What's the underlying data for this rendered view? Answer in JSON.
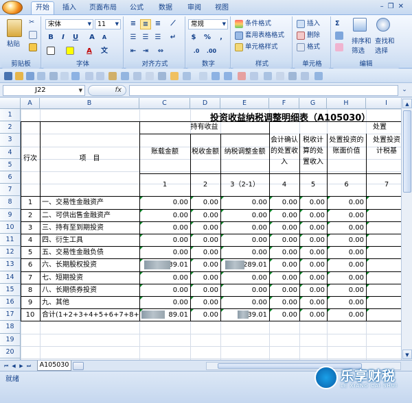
{
  "ribbon_tabs": [
    "开始",
    "插入",
    "页面布局",
    "公式",
    "数据",
    "审阅",
    "视图"
  ],
  "ribbon": {
    "clipboard": {
      "label": "剪贴板",
      "paste": "粘贴"
    },
    "font": {
      "label": "字体",
      "name": "宋体",
      "size": "11"
    },
    "alignment": {
      "label": "对齐方式"
    },
    "number": {
      "label": "数字",
      "format": "常规"
    },
    "styles": {
      "label": "样式",
      "conditional": "条件格式",
      "table_format": "套用表格格式",
      "cell_styles": "单元格样式"
    },
    "cells": {
      "label": "单元格",
      "insert": "插入",
      "delete": "删除",
      "format": "格式"
    },
    "editing": {
      "label": "编辑",
      "sort_filter_1": "排序和",
      "sort_filter_2": "筛选",
      "find_select_1": "查找和",
      "find_select_2": "选择"
    }
  },
  "formula_bar": {
    "name_box": "J22",
    "fx": "fx",
    "formula": ""
  },
  "sheet": {
    "columns": [
      "A",
      "B",
      "C",
      "D",
      "E",
      "F",
      "G",
      "H",
      "I"
    ],
    "rows": [
      "1",
      "2",
      "3",
      "4",
      "5",
      "6",
      "7",
      "8",
      "9",
      "10",
      "11",
      "12",
      "13",
      "14",
      "15",
      "16",
      "17",
      "18",
      "19",
      "20",
      "21",
      "22"
    ],
    "title": "投资收益纳税调整明细表（A105030）",
    "header": {
      "seq": "行次",
      "item": "项　目",
      "holding": "持有收益",
      "disposal": "处置",
      "c": "账载金额",
      "d": "税收金额",
      "e": "纳税调整金额",
      "f": [
        "会计确认",
        "的处置收",
        "入"
      ],
      "g": [
        "税收计",
        "算的处",
        "置收入"
      ],
      "h": [
        "处置投资的",
        "账面价值"
      ],
      "i": [
        "处置投资",
        "计税基"
      ],
      "nums": [
        "1",
        "2",
        "3（2-1）",
        "4",
        "5",
        "6",
        "7"
      ]
    },
    "data_rows": [
      {
        "seq": "1",
        "item": "一、交易性金融资产",
        "c": "0.00",
        "d": "0.00",
        "e": "0.00",
        "f": "0.00",
        "g": "0.00",
        "h": "0.00",
        "i": "0"
      },
      {
        "seq": "2",
        "item": "二、可供出售金融资产",
        "c": "0.00",
        "d": "0.00",
        "e": "0.00",
        "f": "0.00",
        "g": "0.00",
        "h": "0.00",
        "i": "0"
      },
      {
        "seq": "3",
        "item": "三、持有至到期投资",
        "c": "0.00",
        "d": "0.00",
        "e": "0.00",
        "f": "0.00",
        "g": "0.00",
        "h": "0.00",
        "i": "0"
      },
      {
        "seq": "4",
        "item": "四、衍生工具",
        "c": "0.00",
        "d": "0.00",
        "e": "0.00",
        "f": "0.00",
        "g": "0.00",
        "h": "0.00",
        "i": "0"
      },
      {
        "seq": "5",
        "item": "五、交易性金融负债",
        "c": "0.00",
        "d": "0.00",
        "e": "0.00",
        "f": "0.00",
        "g": "0.00",
        "h": "0.00",
        "i": "0"
      },
      {
        "seq": "6",
        "item": "六、长期股权投资",
        "c": "39.01",
        "d": "0.00",
        "e": "289.01",
        "f": "0.00",
        "g": "0.00",
        "h": "0.00",
        "i": "0"
      },
      {
        "seq": "7",
        "item": "七、短期投资",
        "c": "0.00",
        "d": "0.00",
        "e": "0.00",
        "f": "0.00",
        "g": "0.00",
        "h": "0.00",
        "i": "0"
      },
      {
        "seq": "8",
        "item": "八、长期债券投资",
        "c": "0.00",
        "d": "0.00",
        "e": "0.00",
        "f": "0.00",
        "g": "0.00",
        "h": "0.00",
        "i": "0"
      },
      {
        "seq": "9",
        "item": "九、其他",
        "c": "0.00",
        "d": "0.00",
        "e": "0.00",
        "f": "0.00",
        "g": "0.00",
        "h": "0.00",
        "i": "0"
      },
      {
        "seq": "10",
        "item": "合计(1+2+3+4+5+6+7+8+9)",
        "c": "89.01",
        "d": "0.00",
        "e": "39.01",
        "f": "0.00",
        "g": "0.00",
        "h": "0.00",
        "i": "0"
      }
    ]
  },
  "sheet_tab": "A105030",
  "status": "就绪",
  "watermark": {
    "main": "乐享财税",
    "sub": "LE XIANG CAI SHUI"
  },
  "colors": {
    "accent": "#15428b",
    "ribbon_bg": "#dfe9f7",
    "green_triangle": "#0a8a2a"
  }
}
